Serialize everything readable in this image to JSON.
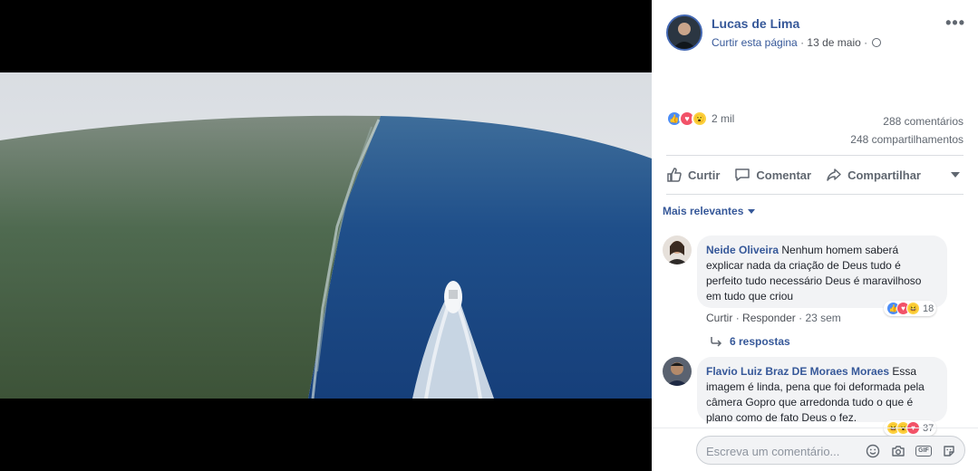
{
  "post": {
    "author": "Lucas de Lima",
    "like_page": "Curtir esta página",
    "separator": "·",
    "date": "13 de maio",
    "reactions_count": "2 mil",
    "comments_count": "288 comentários",
    "shares_count": "248 compartilhamentos"
  },
  "actions": {
    "like": "Curtir",
    "comment": "Comentar",
    "share": "Compartilhar"
  },
  "sort_label": "Mais relevantes",
  "comments": [
    {
      "name": "Neide Oliveira",
      "text": "Nenhum homem saberá explicar nada da criação de Deus tudo é perfeito tudo necessário Deus é maravilhoso em tudo que criou",
      "like": "Curtir",
      "reply": "Responder",
      "time": "23 sem",
      "reaction_count": "18"
    },
    {
      "name": "Flavio Luiz Braz DE Moraes Moraes",
      "text": "Essa imagem é linda, pena que foi deformada pela câmera Gopro que arredonda tudo o que é plano como de fato Deus o fez.",
      "reaction_count": "37"
    }
  ],
  "replies_label": "6 respostas",
  "composer": {
    "placeholder": "Escreva um comentário..."
  },
  "colors": {
    "link_blue": "#365899",
    "like_blue": "#4c8df6",
    "love_red": "#f25268",
    "wow_yellow": "#fcd13f"
  }
}
